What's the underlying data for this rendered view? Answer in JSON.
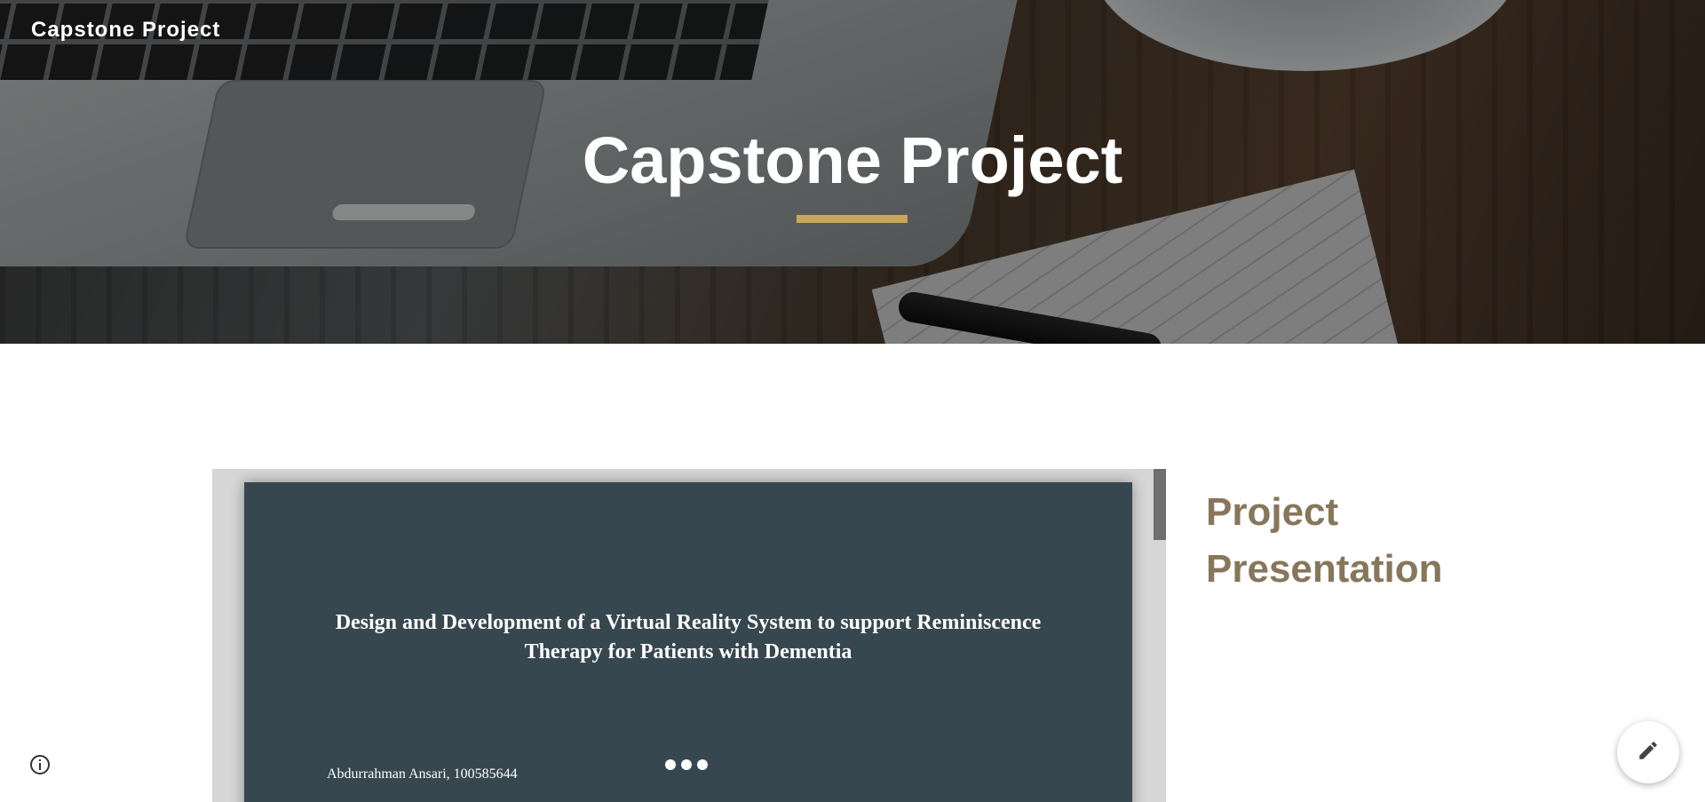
{
  "header": {
    "site_name": "Capstone Project"
  },
  "hero": {
    "title": "Capstone Project",
    "accent_color": "#c9a65a"
  },
  "embed": {
    "slide_title": "Design and Development of a Virtual Reality System to support Reminiscence Therapy for Patients with Dementia",
    "slide_author": "Abdurrahman Ansari, 100585644",
    "slide_background": "#37474f",
    "loading_icon": "more-dots-icon"
  },
  "sidebar": {
    "heading": "Project Presentation",
    "heading_color": "#87765a"
  },
  "controls": {
    "info_icon": "info-icon",
    "edit_icon": "pencil-icon"
  }
}
